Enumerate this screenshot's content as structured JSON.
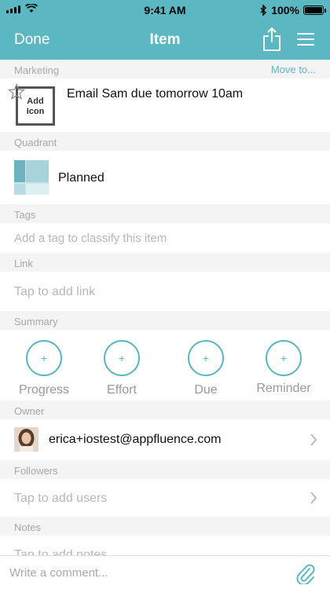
{
  "status_bar": {
    "time": "9:41 AM",
    "battery": "100%"
  },
  "nav": {
    "done_label": "Done",
    "title": "Item"
  },
  "project": {
    "name": "Marketing",
    "move_label": "Move to..."
  },
  "task": {
    "add_icon_label": "Add Icon",
    "title": "Email Sam due tomorrow 10am"
  },
  "quadrant": {
    "header": "Quadrant",
    "value": "Planned"
  },
  "tags": {
    "header": "Tags",
    "placeholder": "Add a tag to classify this item"
  },
  "link": {
    "header": "Link",
    "placeholder": "Tap to add link"
  },
  "summary": {
    "header": "Summary",
    "items": [
      {
        "label": "Progress",
        "symbol": "+"
      },
      {
        "label": "Effort",
        "symbol": "+"
      },
      {
        "label": "Due",
        "symbol": "+"
      },
      {
        "label": "Reminder",
        "symbol": "+"
      }
    ]
  },
  "owner": {
    "header": "Owner",
    "email": "erica+iostest@appfluence.com"
  },
  "followers": {
    "header": "Followers",
    "placeholder": "Tap to add users"
  },
  "notes": {
    "header": "Notes",
    "placeholder": "Tap to add notes"
  },
  "comment": {
    "placeholder": "Write a comment..."
  },
  "colors": {
    "accent": "#5bb8c2",
    "section_bg": "#f4f4f4",
    "placeholder_text": "#b8b8b8"
  },
  "icons": [
    "signal-icon",
    "wifi-icon",
    "bluetooth-icon",
    "battery-icon",
    "share-icon",
    "menu-icon",
    "star-icon",
    "quadrant-icon",
    "chevron-right-icon",
    "paperclip-icon"
  ]
}
